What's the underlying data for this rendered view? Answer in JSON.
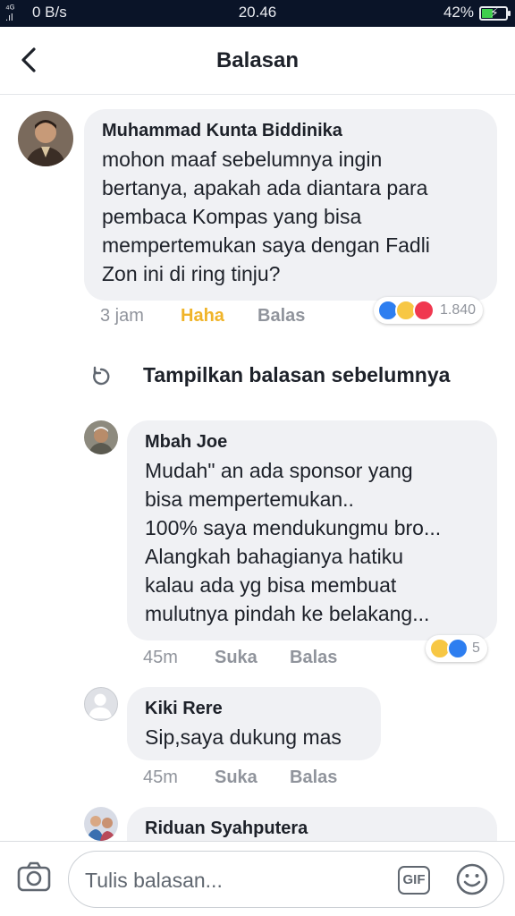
{
  "status_bar": {
    "signal": "4G\n.ıl",
    "network_speed": "0 B/s",
    "time": "20.46",
    "battery": "42%",
    "battery_level": 0.42
  },
  "header": {
    "title": "Balasan"
  },
  "comments": [
    {
      "name": "Muhammad Kunta Biddinika",
      "text": "mohon maaf sebelumnya ingin\nbertanya, apakah ada diantara para\npembaca Kompas yang bisa\nmempertemukan saya dengan Fadli\nZon ini di ring tinju?",
      "time": "3 jam",
      "reaction_label": "Haha",
      "reply_label": "Balas",
      "reaction_icons": [
        "like-icon",
        "haha-icon",
        "love-icon"
      ],
      "reaction_count": "1.840"
    }
  ],
  "show_previous_label": "Tampilkan balasan sebelumnya",
  "replies": [
    {
      "name": "Mbah Joe",
      "text": "Mudah\" an ada sponsor yang\nbisa mempertemukan..\n100% saya mendukungmu bro...\nAlangkah bahagianya hatiku\nkalau ada yg bisa membuat\nmulutnya pindah ke belakang...",
      "time": "45m",
      "like_label": "Suka",
      "reply_label": "Balas",
      "reaction_icons": [
        "haha-icon",
        "like-icon"
      ],
      "reaction_count": "5"
    },
    {
      "name": "Kiki Rere",
      "text": "Sip,saya dukung mas",
      "time": "45m",
      "like_label": "Suka",
      "reply_label": "Balas"
    },
    {
      "name": "Riduan Syahputera"
    }
  ],
  "composer": {
    "placeholder": "Tulis balasan...",
    "gif_label": "GIF"
  },
  "colors": {
    "haha_text": "#f0b429",
    "like_blue": "#2d7ef0",
    "love_red": "#f0384f",
    "bubble_bg": "#f0f1f4"
  }
}
